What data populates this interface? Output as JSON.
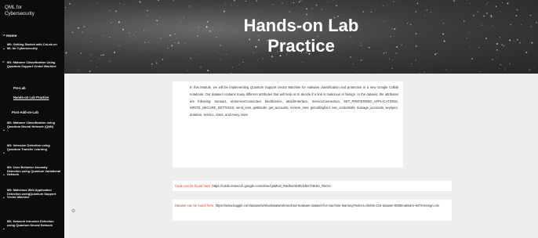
{
  "site": {
    "title_line1": "QML for",
    "title_line2": "Cybersecurity"
  },
  "nav": {
    "home": "Home",
    "items": [
      {
        "label": "M0: Getting Started with CoLab on ML for Cybersecurity"
      },
      {
        "label": "M1: Malware Classification Using Quantum Support Vector Machine"
      },
      {
        "label": "M2: Malware Classification using Quantum Neural Network (QNN)"
      },
      {
        "label": "M3: Intrusion Detection using Quantum Transfer Learning"
      },
      {
        "label": "M4: User Behavior Anomaly Detection using Quantum Variational Network"
      },
      {
        "label": "M5: Malicious Web Application Detection usingQuantum Support Vector Machine"
      },
      {
        "label": "M6: Network Intrusion Detection using Quantum Neural Network"
      }
    ],
    "subitems": {
      "pre_lab": "Pre-Lab",
      "hands_on": "Hands-on Lab Practice",
      "post_add": "Post-Add-on-Lab"
    }
  },
  "hero": {
    "title_line1": "Hands-on Lab",
    "title_line2": "Practice"
  },
  "intro": {
    "text": "In this Module, we will be implementing Quantum Support Vector Machine for malware classification and protection in a new Google Collab notebook. Our dataset contains many different attributes that will help us to decide if a link is malicious or benign. In the dataset, the attributes are following: transact, onServiceConnected, bindService, attachInterface, ServiceConnection, SET_PREFERRED_APPLICATIONS, WRITE_SECURE_SETTINGS, send_sms, getBinder, get_accounts, recieve_sms, getcallinglUid, use_credentials, manage_accounts, keyspec, duration, service, class, and many more."
  },
  "links": {
    "code_label": "Code can be found here:",
    "code_url": "https://colab.research.google.com/drive/1jsMU8_R6dhomE9hrlzlbvTl4KEe_RkiGs",
    "dataset_label": "Dataset can be found here:",
    "dataset_url": "https://www.kaggle.com/datasets/shashwatwork/android-malware-dataset-for-machine-learning?select=drebin-215-dataset-5560malware-9476-benign.csv"
  },
  "icons": {
    "chevron_down": "⌄",
    "chevron_up": "^",
    "settings": "⊙"
  },
  "colors": {
    "sidebar": "#0c0c0c",
    "link_label": "#d9372a",
    "page_bg": "#eeeeee"
  }
}
